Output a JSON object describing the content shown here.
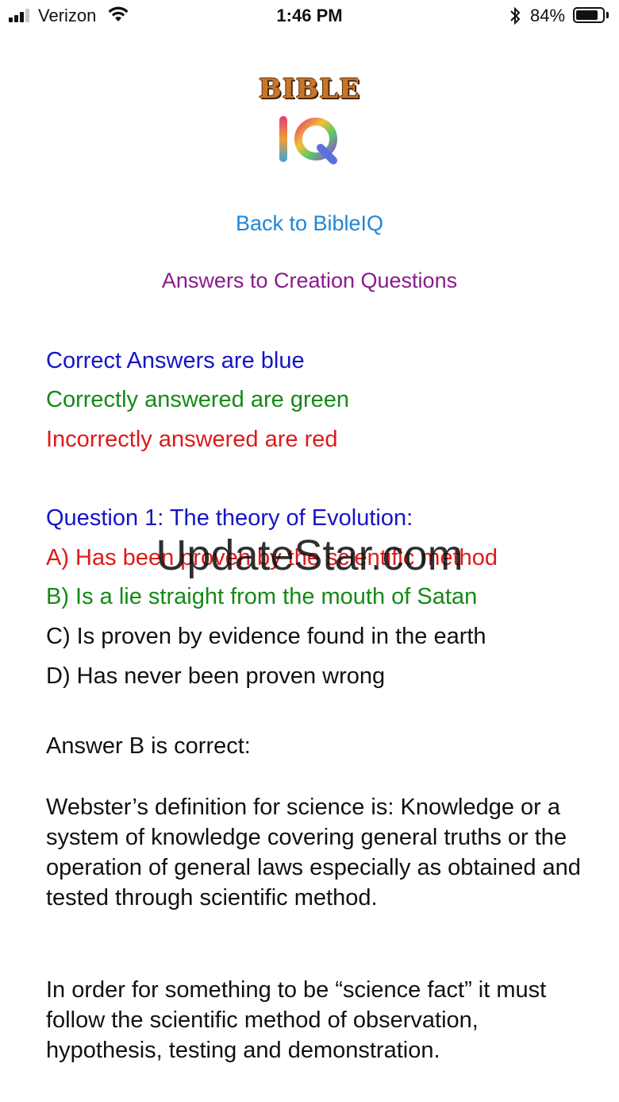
{
  "status_bar": {
    "carrier": "Verizon",
    "time": "1:46 PM",
    "battery_percent": "84%",
    "battery_level": 0.84
  },
  "logo": {
    "word": "BIBLE",
    "iq": "IQ"
  },
  "nav": {
    "back_link": "Back to BibleIQ"
  },
  "page_title": "Answers to Creation Questions",
  "legend": {
    "correct": "Correct Answers are blue",
    "correctly_answered": "Correctly answered are green",
    "incorrectly_answered": "Incorrectly answered are red"
  },
  "question": {
    "text": "Question 1: The theory of Evolution:",
    "options": [
      "A) Has been proven by the scientific method",
      "B) Is a lie straight from the mouth of Satan",
      "C) Is proven by evidence found in the earth",
      "D) Has never been proven wrong"
    ]
  },
  "answer": {
    "heading": "Answer B is correct:",
    "paragraphs": [
      "Webster’s definition for science is: Knowledge or a system of knowledge covering general truths or the operation of general laws especially as obtained and tested through scientific method.",
      "In order for something to be “science fact” it must follow the scientific method of observation, hypothesis, testing and demonstration."
    ]
  },
  "watermark": "UpdateStar.com",
  "colors": {
    "link": "#1f86d6",
    "title": "#8b1a8b",
    "correct_blue": "#1515c4",
    "answered_green": "#158a15",
    "wrong_red": "#dd1a1a"
  },
  "icons": [
    "cellular-signal-icon",
    "wifi-icon",
    "bluetooth-icon",
    "battery-icon"
  ]
}
